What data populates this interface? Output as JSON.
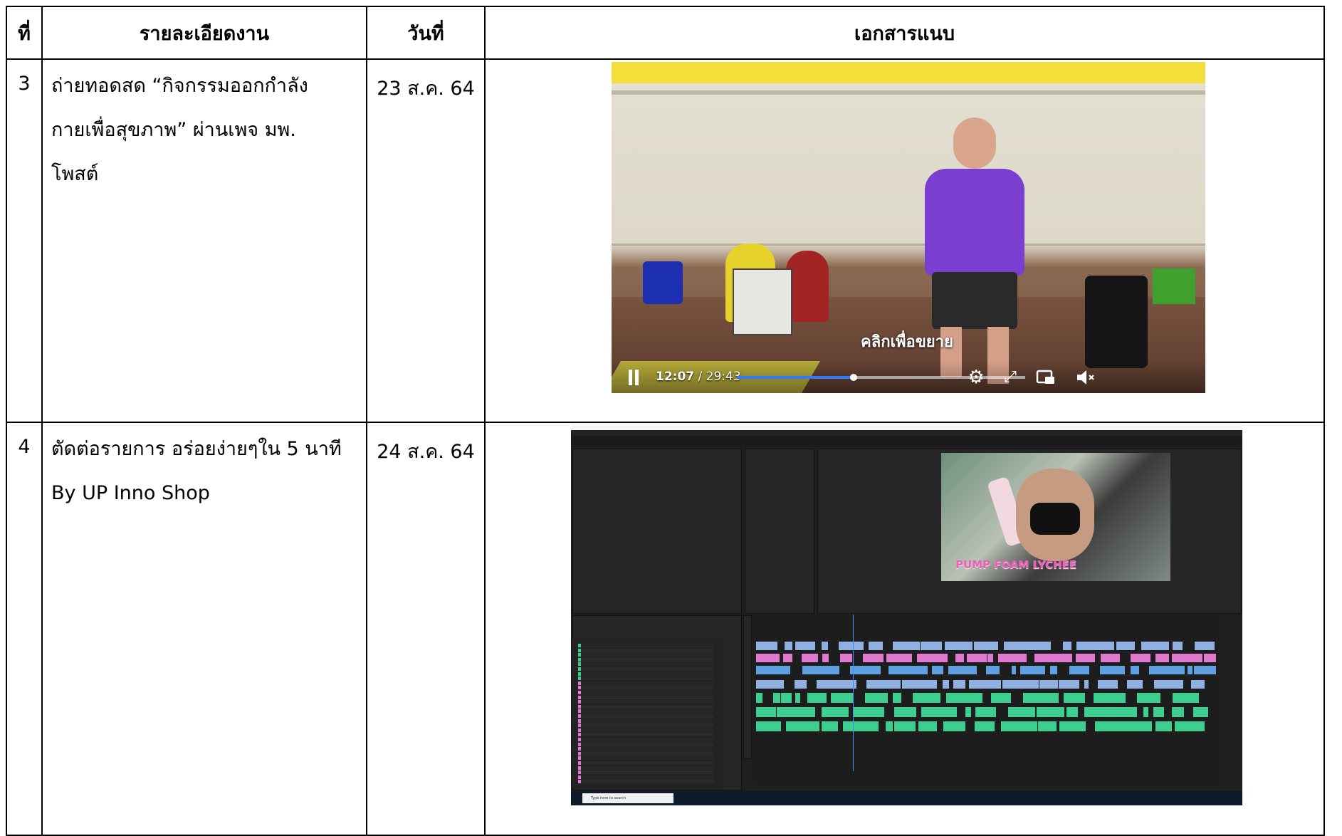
{
  "table": {
    "headers": {
      "no": "ที่",
      "detail": "รายละเอียดงาน",
      "date": "วันที่",
      "attachment": "เอกสารแนบ"
    },
    "rows": [
      {
        "no": "3",
        "detail_lines": [
          "ถ่ายทอดสด “กิจกรรมออกกำลัง",
          "กายเพื่อสุขภาพ” ผ่านเพจ มพ.",
          "โพสต์"
        ],
        "date": "23 ส.ค. 64"
      },
      {
        "no": "4",
        "detail_lines": [
          "ตัดต่อรายการ อร่อยง่ายๆใน 5 นาที",
          "By UP Inno Shop"
        ],
        "date": "24 ส.ค. 64"
      }
    ]
  },
  "video_player": {
    "overlay_text": "คลิกเพื่อขยาย",
    "current_time": "12:07",
    "total_time": " / 29:43",
    "progress_fraction": 0.406,
    "icons": [
      "pause-icon",
      "gear-icon",
      "fullscreen-icon",
      "picture-in-picture-icon",
      "mute-icon"
    ]
  },
  "premiere": {
    "monitor_caption": "PUMP FOAM LYCHEE",
    "taskbar_search_placeholder": "Type here to search",
    "accent_color": "#2f7bf3"
  }
}
